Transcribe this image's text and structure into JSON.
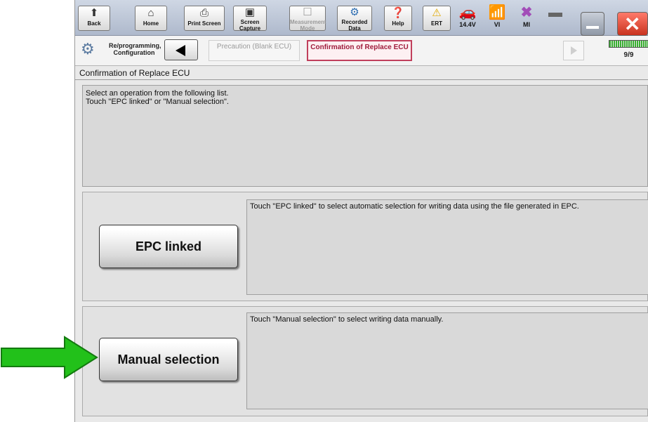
{
  "toolbar": {
    "buttons": [
      {
        "label": "Back",
        "icon": "back-arrow-icon"
      },
      {
        "label": "Home",
        "icon": "home-icon"
      },
      {
        "label": "Print Screen",
        "icon": "printer-icon"
      },
      {
        "label": "Screen Capture",
        "icon": "camera-icon"
      },
      {
        "label": "Measurement Mode",
        "icon": "measure-icon"
      },
      {
        "label": "Recorded Data",
        "icon": "recorded-data-icon"
      },
      {
        "label": "Help",
        "icon": "help-icon"
      },
      {
        "label": "ERT",
        "icon": "warning-icon"
      }
    ],
    "status": [
      {
        "label": "14.4V",
        "icon": "car-battery-icon"
      },
      {
        "label": "VI",
        "icon": "signal-icon"
      },
      {
        "label": "MI",
        "icon": "mi-x-icon"
      }
    ]
  },
  "breadcrumb": {
    "section": "Re/programming, Configuration",
    "prev_step": "Precaution (Blank ECU)",
    "current_step": "Confirmation of Replace ECU",
    "progress": "9/9"
  },
  "page": {
    "title": "Confirmation of Replace ECU",
    "instruction_line1": "Select an operation from the following list.",
    "instruction_line2": "Touch \"EPC linked\" or \"Manual selection\"."
  },
  "options": [
    {
      "button": "EPC linked",
      "description": "Touch \"EPC linked\" to select automatic selection for writing data using the file generated in EPC."
    },
    {
      "button": "Manual selection",
      "description": "Touch \"Manual selection\" to select writing data manually."
    }
  ],
  "colors": {
    "accent": "#c0405c",
    "arrow": "#22c11a",
    "progress": "#38b030"
  }
}
